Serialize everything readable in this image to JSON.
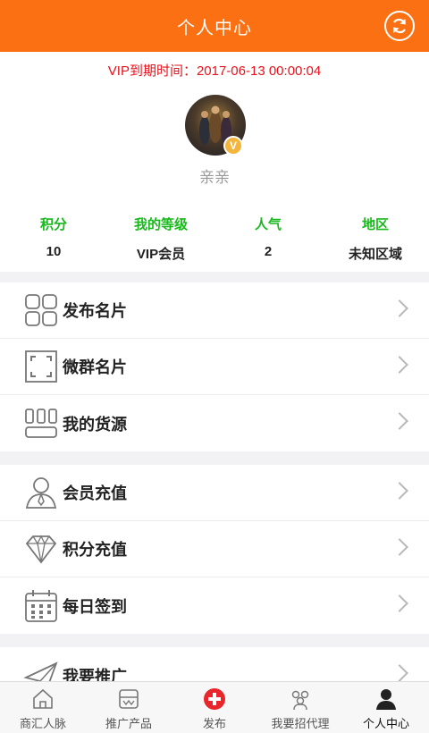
{
  "header": {
    "title": "个人中心",
    "refresh_icon": "refresh-icon"
  },
  "profile": {
    "vip_expiry": "VIP到期时间：2017-06-13 00:00:04",
    "nickname": "亲亲",
    "badge": "V",
    "stats": [
      {
        "label": "积分",
        "value": "10"
      },
      {
        "label": "我的等级",
        "value": "VIP会员"
      },
      {
        "label": "人气",
        "value": "2"
      },
      {
        "label": "地区",
        "value": "未知区域"
      }
    ]
  },
  "menu_groups": [
    {
      "items": [
        {
          "label": "发布名片",
          "icon": "grid-icon"
        },
        {
          "label": "微群名片",
          "icon": "scan-frame-icon"
        },
        {
          "label": "我的货源",
          "icon": "shelves-icon"
        }
      ]
    },
    {
      "items": [
        {
          "label": "会员充值",
          "icon": "member-icon"
        },
        {
          "label": "积分充值",
          "icon": "diamond-icon"
        },
        {
          "label": "每日签到",
          "icon": "calendar-icon"
        }
      ]
    },
    {
      "items": [
        {
          "label": "我要推广",
          "icon": "paper-plane-icon"
        }
      ]
    }
  ],
  "tabbar": {
    "tabs": [
      {
        "label": "商汇人脉",
        "icon": "home-icon"
      },
      {
        "label": "推广产品",
        "icon": "product-icon"
      },
      {
        "label": "发布",
        "icon": "add-circle-icon"
      },
      {
        "label": "我要招代理",
        "icon": "group-icon"
      },
      {
        "label": "个人中心",
        "icon": "person-icon"
      }
    ],
    "active_index": 4
  },
  "colors": {
    "header": "#fb7012",
    "vip_text": "#e8121c",
    "stat_label": "#19b81c",
    "publish": "#e8262b"
  }
}
